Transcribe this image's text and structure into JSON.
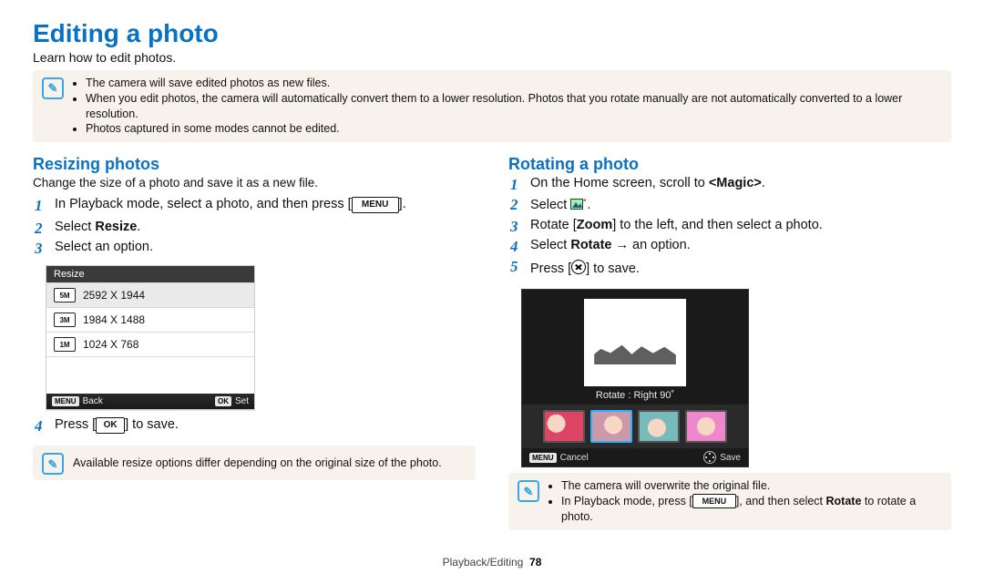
{
  "page_title": "Editing a photo",
  "intro": "Learn how to edit photos.",
  "top_notes": [
    "The camera will save edited photos as new files.",
    "When you edit photos, the camera will automatically convert them to a lower resolution. Photos that you rotate manually are not automatically converted to a lower resolution.",
    "Photos captured in some modes cannot be edited."
  ],
  "left": {
    "heading": "Resizing photos",
    "desc": "Change the size of a photo and save it as a new file.",
    "steps": {
      "s1_pre": "In Playback mode, select a photo, and then press [",
      "s1_btn": "MENU",
      "s1_post": "].",
      "s2_pre": "Select ",
      "s2_bold": "Resize",
      "s2_post": ".",
      "s3": "Select an option.",
      "s4_pre": "Press [",
      "s4_btn": "OK",
      "s4_post": "] to save."
    },
    "ui": {
      "title": "Resize",
      "rows": [
        {
          "badge": "5M",
          "label": "2592 X 1944"
        },
        {
          "badge": "3M",
          "label": "1984 X 1488"
        },
        {
          "badge": "1M",
          "label": "1024 X 768"
        }
      ],
      "foot_back_tag": "MENU",
      "foot_back": "Back",
      "foot_set_tag": "OK",
      "foot_set": "Set"
    },
    "note": "Available resize options differ depending on the original size of the photo."
  },
  "right": {
    "heading": "Rotating a photo",
    "steps": {
      "s1_pre": "On the Home screen, scroll to ",
      "s1_bold": "<Magic>",
      "s1_post": ".",
      "s2_pre": "Select ",
      "s2_post": ".",
      "s3_pre": "Rotate [",
      "s3_bold": "Zoom",
      "s3_post": "] to the left, and then select a photo.",
      "s4_pre": "Select ",
      "s4_bold": "Rotate",
      "s4_mid": " → an option.",
      "s5_pre": "Press [",
      "s5_post": "] to save."
    },
    "ui": {
      "label": "Rotate : Right 90˚",
      "foot_cancel_tag": "MENU",
      "foot_cancel": "Cancel",
      "foot_save": "Save"
    },
    "notes": {
      "n1": "The camera will overwrite the original file.",
      "n2_pre": "In Playback mode, press [",
      "n2_btn": "MENU",
      "n2_mid": "], and then select ",
      "n2_bold": "Rotate",
      "n2_post": " to rotate a photo."
    }
  },
  "footer": {
    "section": "Playback/Editing",
    "page": "78"
  }
}
